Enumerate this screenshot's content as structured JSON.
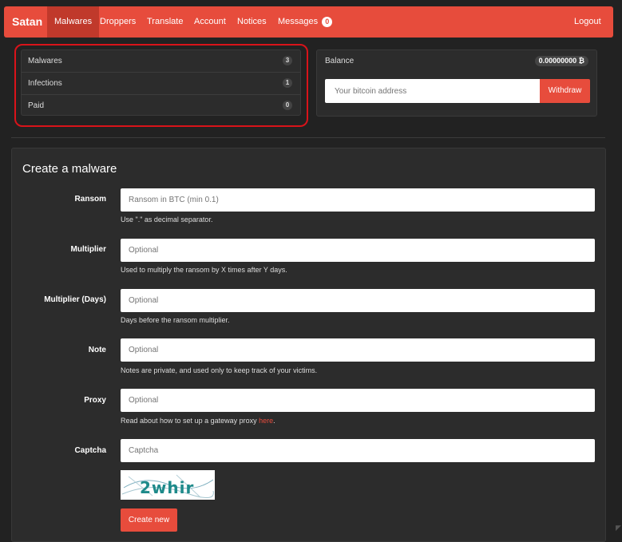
{
  "navbar": {
    "brand": "Satan",
    "items": [
      {
        "label": "Malwares",
        "active": true
      },
      {
        "label": "Droppers"
      },
      {
        "label": "Translate"
      },
      {
        "label": "Account"
      },
      {
        "label": "Notices"
      },
      {
        "label": "Messages",
        "badge": "0"
      }
    ],
    "logout": "Logout"
  },
  "stats": [
    {
      "label": "Malwares",
      "count": "3"
    },
    {
      "label": "Infections",
      "count": "1"
    },
    {
      "label": "Paid",
      "count": "0"
    }
  ],
  "balance": {
    "label": "Balance",
    "value": "0.00000000 ₿",
    "placeholder": "Your bitcoin address",
    "withdraw": "Withdraw"
  },
  "form": {
    "title": "Create a malware",
    "fields": [
      {
        "label": "Ransom",
        "placeholder": "Ransom in BTC (min 0.1)",
        "help": "Use \".\" as decimal separator."
      },
      {
        "label": "Multiplier",
        "placeholder": "Optional",
        "help": "Used to multiply the ransom by X times after Y days."
      },
      {
        "label": "Multiplier (Days)",
        "placeholder": "Optional",
        "help": "Days before the ransom multiplier."
      },
      {
        "label": "Note",
        "placeholder": "Optional",
        "help": "Notes are private, and used only to keep track of your victims."
      },
      {
        "label": "Proxy",
        "placeholder": "Optional",
        "help": "Read about how to set up a gateway proxy ",
        "link": "here",
        "help_end": "."
      },
      {
        "label": "Captcha",
        "placeholder": "Captcha"
      }
    ],
    "captcha_text": "2whir",
    "submit": "Create new"
  },
  "colors": {
    "accent": "#e74c3c",
    "background": "#222222",
    "panel": "#2c2c2c",
    "highlight": "#d9131a"
  }
}
